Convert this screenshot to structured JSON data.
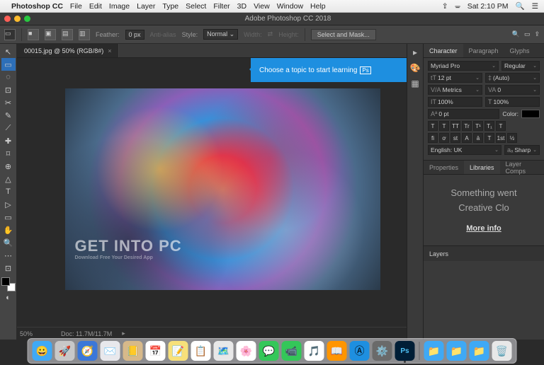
{
  "mac_menu": {
    "app_name": "Photoshop CC",
    "items": [
      "File",
      "Edit",
      "Image",
      "Layer",
      "Type",
      "Select",
      "Filter",
      "3D",
      "View",
      "Window",
      "Help"
    ],
    "time": "Sat 2:10 PM"
  },
  "window": {
    "title": "Adobe Photoshop CC 2018"
  },
  "options_bar": {
    "feather_label": "Feather:",
    "feather_value": "0 px",
    "antialias_label": "Anti-alias",
    "style_label": "Style:",
    "style_value": "Normal",
    "width_label": "Width:",
    "height_label": "Height:",
    "select_mask": "Select and Mask..."
  },
  "document": {
    "tab_label": "00015.jpg @ 50% (RGB/8#)",
    "zoom": "50%",
    "doc_size": "Doc: 11.7M/11.7M"
  },
  "learn_popup": {
    "text": "Choose a topic to start learning",
    "badge": "Ps"
  },
  "watermark": {
    "big": "GET INTO PC",
    "small": "Download Free Your Desired App"
  },
  "panels": {
    "char_tabs": [
      "Character",
      "Paragraph",
      "Glyphs"
    ],
    "font_family": "Myriad Pro",
    "font_style": "Regular",
    "font_size": "12 pt",
    "leading": "(Auto)",
    "kerning": "Metrics",
    "tracking": "0",
    "vscale": "100%",
    "hscale": "100%",
    "baseline": "0 pt",
    "color_label": "Color:",
    "style1": [
      "T",
      "T",
      "TT",
      "Tr",
      "T¹",
      "T₁",
      "T"
    ],
    "style2": [
      "fi",
      "ơ",
      "st",
      "A",
      "ā",
      "T",
      "1st",
      "½"
    ],
    "lang": "English: UK",
    "aa": "Sharp",
    "lib_tabs": [
      "Properties",
      "Libraries",
      "Layer Comps"
    ],
    "lib_msg1": "Something went",
    "lib_msg2": "Creative Clo",
    "lib_link": "More info",
    "layers_label": "Layers"
  },
  "tools": [
    "↖",
    "▭",
    "◌",
    "⊡",
    "✂",
    "✎",
    "⟋",
    "✚",
    "⌑",
    "⊕",
    "△",
    "T",
    "▷",
    "▭",
    "✋",
    "🔍"
  ],
  "dock_apps": [
    {
      "name": "finder",
      "bg": "#3fa9f5",
      "glyph": "😀"
    },
    {
      "name": "launchpad",
      "bg": "#c8c8c8",
      "glyph": "🚀"
    },
    {
      "name": "safari",
      "bg": "#3b77d8",
      "glyph": "🧭"
    },
    {
      "name": "mail",
      "bg": "#e8e8ec",
      "glyph": "✉️"
    },
    {
      "name": "contacts",
      "bg": "#d7b98a",
      "glyph": "📒"
    },
    {
      "name": "calendar",
      "bg": "#fff",
      "glyph": "📅"
    },
    {
      "name": "notes",
      "bg": "#f7e07a",
      "glyph": "📝"
    },
    {
      "name": "reminders",
      "bg": "#fff",
      "glyph": "📋"
    },
    {
      "name": "maps",
      "bg": "#e8e8e8",
      "glyph": "🗺️"
    },
    {
      "name": "photos",
      "bg": "#fff",
      "glyph": "🌸"
    },
    {
      "name": "messages",
      "bg": "#34c759",
      "glyph": "💬"
    },
    {
      "name": "facetime",
      "bg": "#34c759",
      "glyph": "📹"
    },
    {
      "name": "itunes",
      "bg": "#fff",
      "glyph": "🎵"
    },
    {
      "name": "ibooks",
      "bg": "#ff9500",
      "glyph": "📖"
    },
    {
      "name": "appstore",
      "bg": "#1e8fe0",
      "glyph": "Ⓐ"
    },
    {
      "name": "preferences",
      "bg": "#6a6a6a",
      "glyph": "⚙️"
    },
    {
      "name": "photoshop",
      "bg": "#001e36",
      "glyph": "Ps"
    }
  ],
  "dock_right": [
    {
      "name": "downloads",
      "bg": "#3fa9f5",
      "glyph": "📁"
    },
    {
      "name": "documents",
      "bg": "#3fa9f5",
      "glyph": "📁"
    },
    {
      "name": "folder",
      "bg": "#3fa9f5",
      "glyph": "📁"
    },
    {
      "name": "trash",
      "bg": "#e8e8e8",
      "glyph": "🗑️"
    }
  ]
}
